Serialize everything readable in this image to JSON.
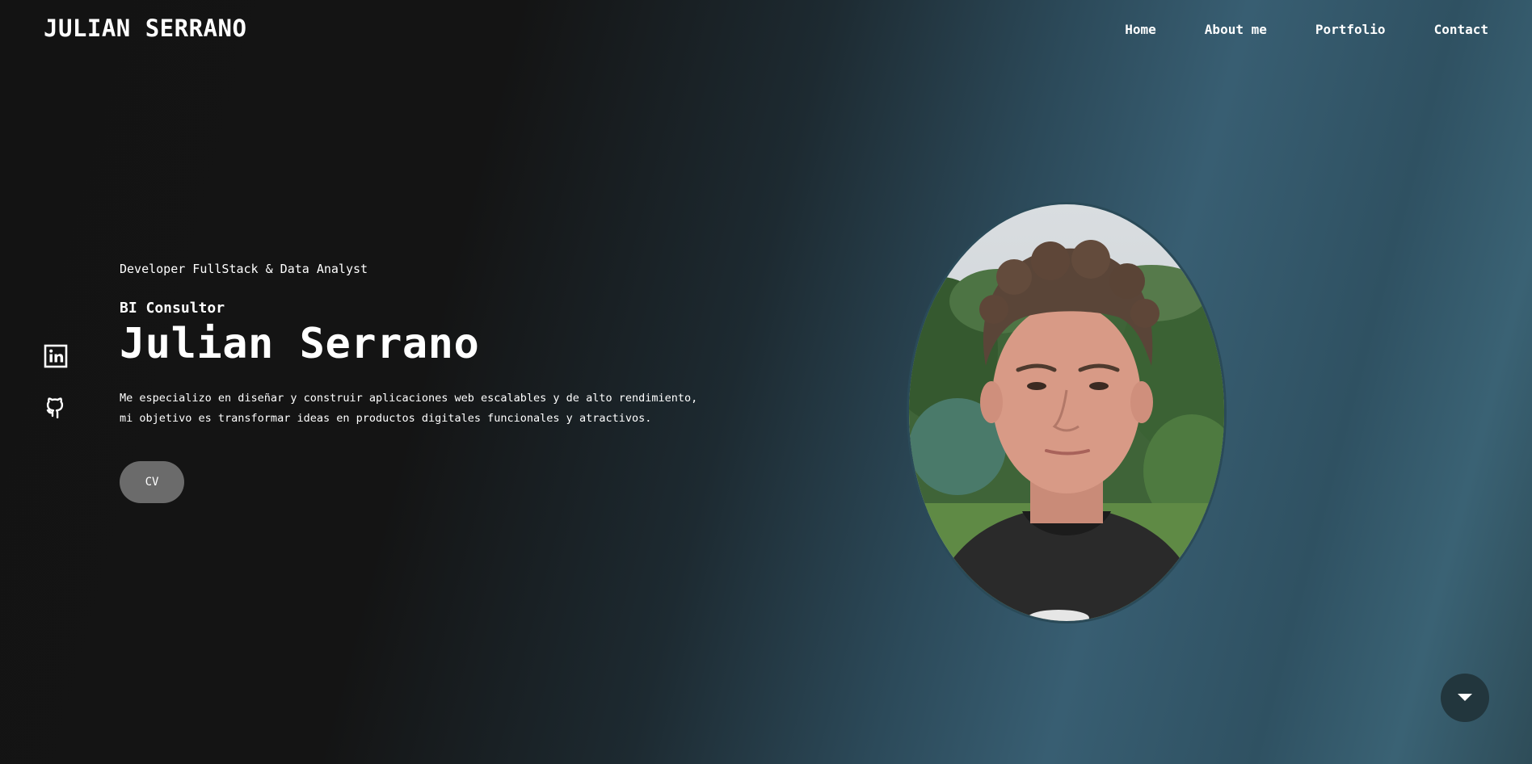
{
  "header": {
    "logo": "JULIAN SERRANO",
    "nav": [
      "Home",
      "About me",
      "Portfolio",
      "Contact"
    ]
  },
  "hero": {
    "subtitle": "Developer FullStack & Data Analyst",
    "role": "BI Consultor",
    "name": "Julian Serrano",
    "description_line1": "Me especializo en diseñar y construir aplicaciones web escalables y de alto rendimiento,",
    "description_line2": "mi objetivo es transformar ideas en productos digitales funcionales y atractivos.",
    "cv_label": "CV"
  },
  "social": {
    "icons": [
      "linkedin-icon",
      "github-icon"
    ]
  },
  "scroll_button": {
    "icon": "chevron-down-icon"
  },
  "colors": {
    "background_dark": "#131313",
    "background_teal": "#385e72",
    "button_gray": "#6b6b6b",
    "scroll_button": "#22363d"
  }
}
